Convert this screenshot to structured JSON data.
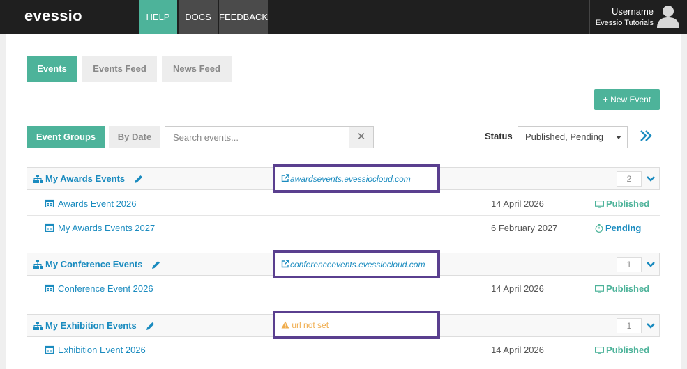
{
  "header": {
    "logo": "evessio",
    "nav": [
      "HELP",
      "DOCS",
      "FEEDBACK"
    ],
    "username": "Username",
    "org": "Evessio Tutorials"
  },
  "tabs": [
    "Events",
    "Events Feed",
    "News Feed"
  ],
  "new_event_label": "New Event",
  "filters": {
    "group_by": [
      "Event Groups",
      "By Date"
    ],
    "search_placeholder": "Search events...",
    "status_label": "Status",
    "status_value": "Published, Pending"
  },
  "groups": [
    {
      "name": "My Awards Events",
      "url": "awardsevents.evessiocloud.com",
      "count": "2",
      "events": [
        {
          "name": "Awards Event 2026",
          "date": "14 April 2026",
          "status": "Published"
        },
        {
          "name": "My Awards Events 2027",
          "date": "6 February 2027",
          "status": "Pending"
        }
      ]
    },
    {
      "name": "My Conference Events",
      "url": "conferenceevents.evessiocloud.com",
      "count": "1",
      "events": [
        {
          "name": "Conference Event 2026",
          "date": "14 April 2026",
          "status": "Published"
        }
      ]
    },
    {
      "name": "My Exhibition Events",
      "url_warning": "url not set",
      "count": "1",
      "events": [
        {
          "name": "Exhibition Event 2026",
          "date": "14 April 2026",
          "status": "Published"
        }
      ]
    }
  ],
  "colors": {
    "accent": "#4db39a",
    "link": "#1a8bbf",
    "highlight_box": "#5a3f8f",
    "warning": "#f0ad4e",
    "topbar": "#1f1f1f"
  }
}
